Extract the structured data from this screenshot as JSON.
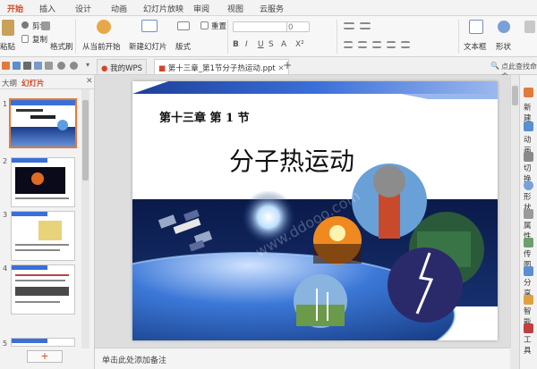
{
  "ribbon_tabs": [
    "开始",
    "插入",
    "设计",
    "动画",
    "幻灯片放映",
    "审阅",
    "视图",
    "云服务"
  ],
  "ribbon": {
    "paste": "粘贴",
    "cut": "剪切",
    "copy": "复制",
    "format_painter": "格式刷",
    "from_current": "从当前开始",
    "new_slide": "新建幻灯片",
    "layout": "版式",
    "reset": "重置",
    "font_size": "0",
    "textbox": "文本框",
    "shape": "形状",
    "arrange": "排列"
  },
  "search_placeholder": "点此查找命令",
  "doc_tabs": [
    {
      "label": "我的WPS"
    },
    {
      "label": "第十三章_第1节分子热运动.ppt"
    }
  ],
  "left_pane": {
    "tab_outline": "大纲",
    "tab_slides": "幻灯片",
    "slide_numbers": [
      "1",
      "2",
      "3",
      "4",
      "5"
    ],
    "add_button": "+"
  },
  "slide": {
    "chapter": "第十三章  第 1 节",
    "title": "分子热运动",
    "watermark": "www.ddooo.com"
  },
  "notes_placeholder": "单击此处添加备注",
  "right_pane": [
    "新建",
    "动画",
    "切换",
    "形状",
    "属性",
    "传图",
    "分享",
    "智能",
    "工具"
  ],
  "colors": {
    "accent": "#d24726",
    "slide_blue": "#3b6fd8"
  }
}
